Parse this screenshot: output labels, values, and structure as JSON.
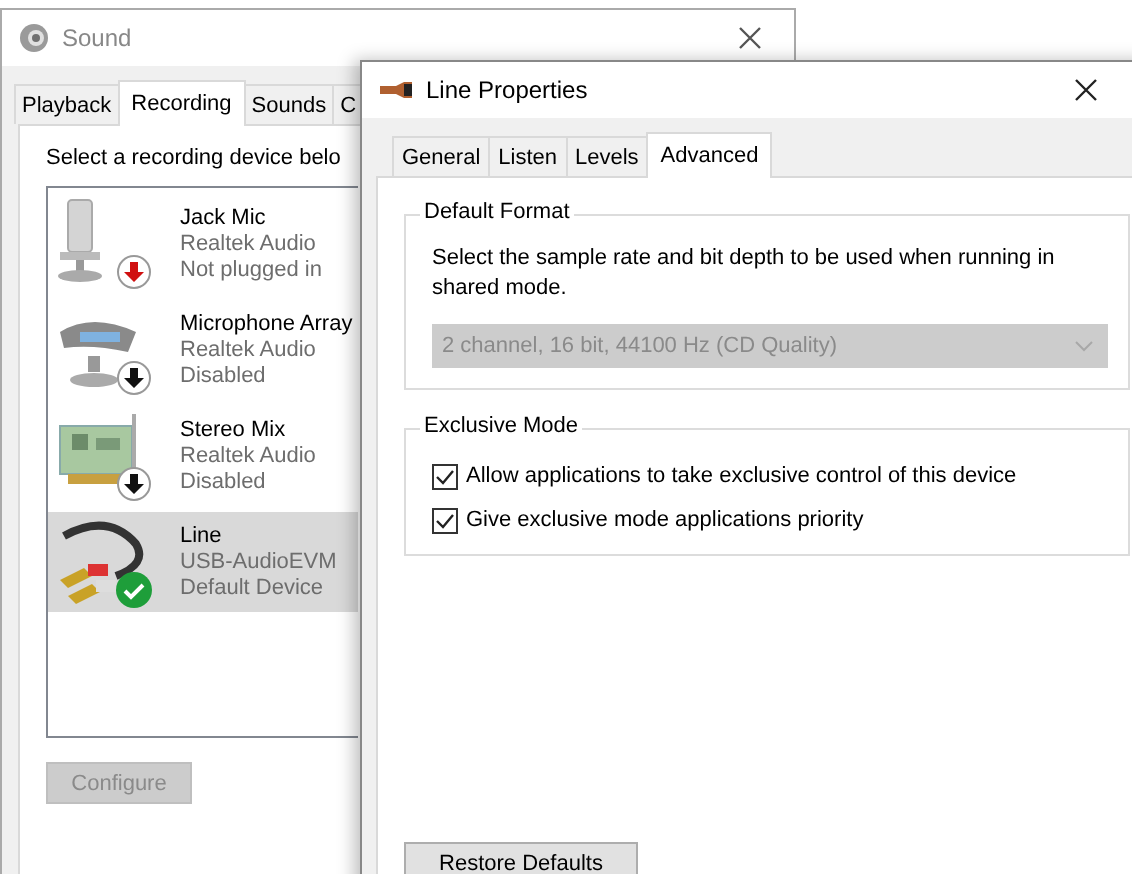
{
  "sound_window": {
    "title": "Sound",
    "tabs": [
      {
        "label": "Playback",
        "selected": false
      },
      {
        "label": "Recording",
        "selected": true
      },
      {
        "label": "Sounds",
        "selected": false
      },
      {
        "label": "C",
        "selected": false
      }
    ],
    "instruction": "Select a recording device belo",
    "devices": [
      {
        "kind": "mic",
        "name": "Jack Mic",
        "driver": "Realtek Audio",
        "status": "Not plugged in",
        "unplugged": true,
        "disabled": false,
        "default": false,
        "selected": false
      },
      {
        "kind": "array",
        "name": "Microphone Array",
        "driver": "Realtek Audio",
        "status": "Disabled",
        "unplugged": false,
        "disabled": true,
        "default": false,
        "selected": false
      },
      {
        "kind": "card",
        "name": "Stereo Mix",
        "driver": "Realtek Audio",
        "status": "Disabled",
        "unplugged": false,
        "disabled": true,
        "default": false,
        "selected": false
      },
      {
        "kind": "cable",
        "name": "Line",
        "driver": "USB-AudioEVM",
        "status": "Default Device",
        "unplugged": false,
        "disabled": false,
        "default": true,
        "selected": true
      }
    ],
    "configure_button": {
      "label": "Configure",
      "disabled": true
    }
  },
  "properties_window": {
    "title": "Line Properties",
    "tabs": [
      {
        "label": "General",
        "selected": false
      },
      {
        "label": "Listen",
        "selected": false
      },
      {
        "label": "Levels",
        "selected": false
      },
      {
        "label": "Advanced",
        "selected": true
      }
    ],
    "default_format": {
      "title": "Default Format",
      "description": "Select the sample rate and bit depth to be used when running in shared mode.",
      "format": {
        "value": "2 channel, 16 bit, 44100 Hz (CD Quality)",
        "disabled": true
      }
    },
    "exclusive_mode": {
      "title": "Exclusive Mode",
      "options": [
        {
          "label": "Allow applications to take exclusive control of this device",
          "checked": true
        },
        {
          "label": "Give exclusive mode applications priority",
          "checked": true
        }
      ]
    },
    "restore_button": "Restore Defaults"
  }
}
